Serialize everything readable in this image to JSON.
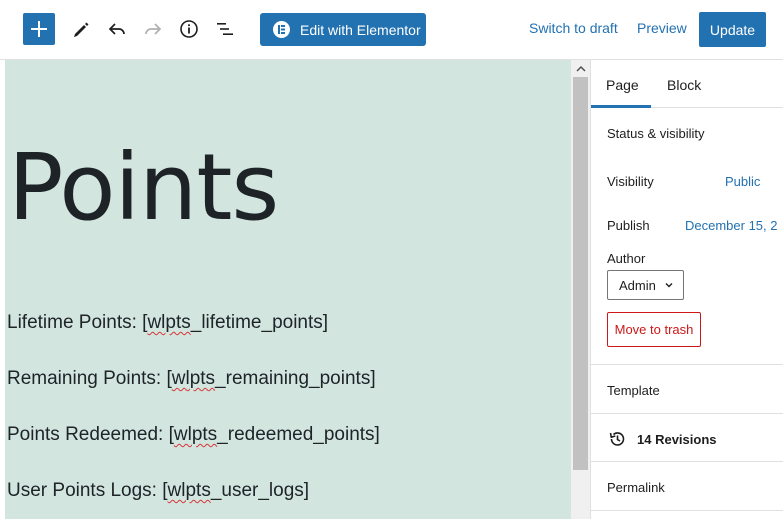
{
  "toolbar": {
    "add_icon": "plus-icon",
    "tools_icon": "pencil-icon",
    "undo_icon": "undo-icon",
    "redo_icon": "redo-icon",
    "info_icon": "info-icon",
    "outline_icon": "list-view-icon",
    "elementor_label": "Edit with Elementor",
    "switch_draft_label": "Switch to draft",
    "preview_label": "Preview",
    "update_label": "Update",
    "accent_color": "#2271b1"
  },
  "content": {
    "title": "Points",
    "paragraphs": [
      {
        "label": "Lifetime Points: [",
        "code": "wlpts",
        "rest": "_lifetime_points]"
      },
      {
        "label": "Remaining Points: [",
        "code": "wlpts",
        "rest": "_remaining_points]"
      },
      {
        "label": "Points Redeemed: [",
        "code": "wlpts",
        "rest": "_redeemed_points]"
      },
      {
        "label": "User Points Logs: [",
        "code": "wlpts",
        "rest": "_user_logs]"
      }
    ],
    "background_color": "#d3e5df"
  },
  "sidebar": {
    "tabs": [
      {
        "label": "Page",
        "active": true
      },
      {
        "label": "Block",
        "active": false
      }
    ],
    "status_visibility_label": "Status & visibility",
    "visibility_label": "Visibility",
    "visibility_value": "Public",
    "publish_label": "Publish",
    "publish_value": "December 15, 2",
    "author_label": "Author",
    "author_value": "Admin",
    "trash_label": "Move to trash",
    "template_label": "Template",
    "revisions_label": "14 Revisions",
    "revisions_icon": "history-icon",
    "permalink_label": "Permalink"
  }
}
